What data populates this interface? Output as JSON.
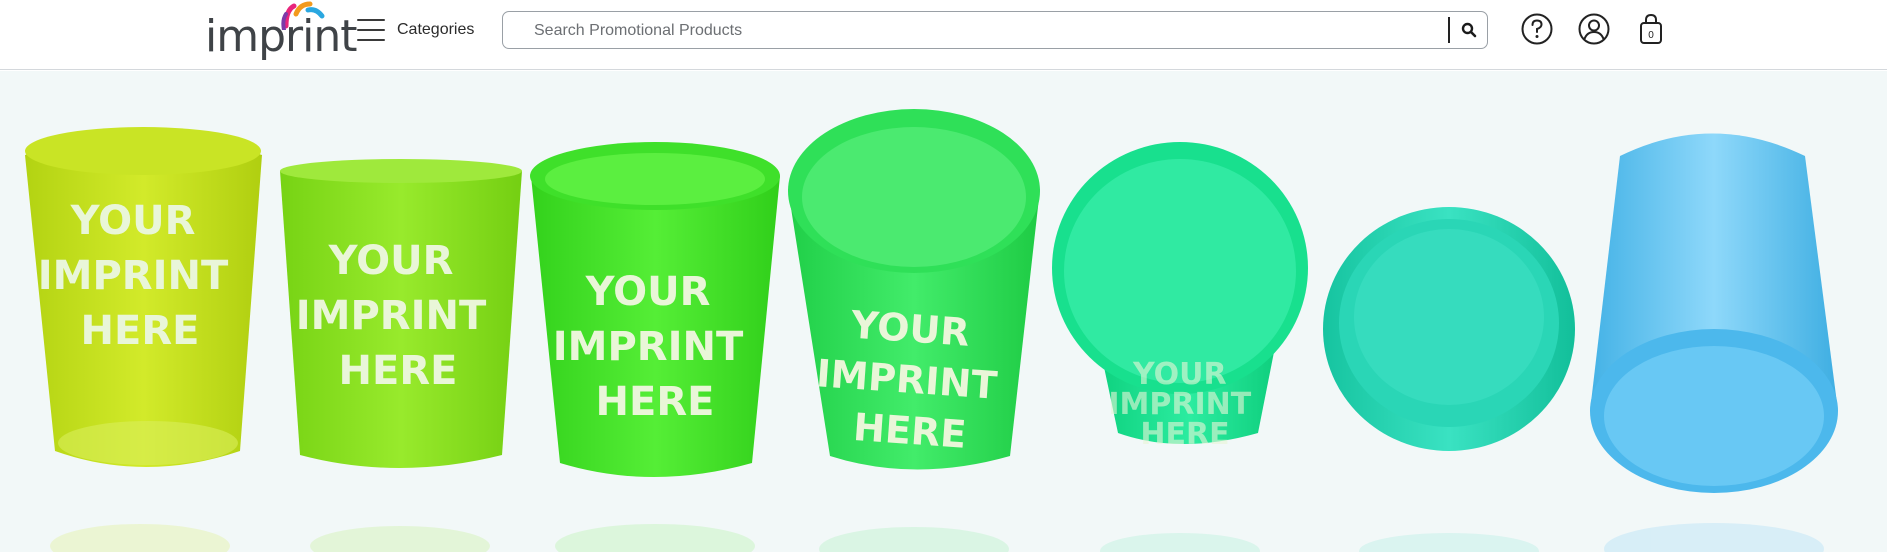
{
  "header": {
    "logo": {
      "text": "imprint",
      "icon": "rainbow-swoosh-logo"
    },
    "categories": {
      "label": "Categories",
      "icon": "hamburger-menu-icon"
    },
    "search": {
      "placeholder": "Search Promotional Products",
      "value": "",
      "icon": "search-icon"
    },
    "actions": [
      {
        "name": "help",
        "icon": "question-circle-icon"
      },
      {
        "name": "account",
        "icon": "user-circle-icon"
      },
      {
        "name": "cart",
        "icon": "shopping-bag-icon",
        "count": "0"
      }
    ]
  },
  "hero": {
    "product": "stadium cups",
    "cups": [
      {
        "color": "#c5e01a",
        "imprint": [
          "YOUR",
          "IMPRINT",
          "HERE"
        ]
      },
      {
        "color": "#8de41e",
        "imprint": [
          "YOUR",
          "IMPRINT",
          "HERE"
        ]
      },
      {
        "color": "#44e42a",
        "imprint": [
          "YOUR",
          "IMPRINT",
          "HERE"
        ]
      },
      {
        "color": "#2fe05a",
        "imprint": [
          "YOUR",
          "IMPRINT",
          "HERE"
        ]
      },
      {
        "color": "#14e08c",
        "imprint": [
          "YOUR",
          "IMPRINT",
          "HERE"
        ]
      },
      {
        "color": "#1ed4b0",
        "imprint": []
      },
      {
        "color": "#5ec3f0",
        "imprint": []
      }
    ]
  }
}
